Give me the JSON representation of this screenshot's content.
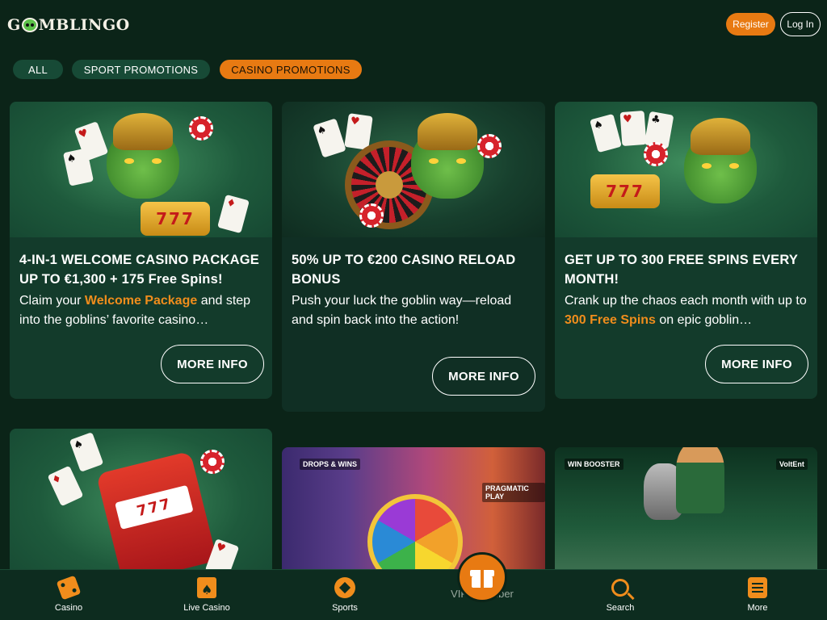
{
  "header": {
    "logo_text": "GOBLINGO",
    "register_label": "Register",
    "login_label": "Log In"
  },
  "tabs": [
    {
      "label": "ALL",
      "active": false
    },
    {
      "label": "SPORT PROMOTIONS",
      "active": false
    },
    {
      "label": "CASINO PROMOTIONS",
      "active": true
    }
  ],
  "promotions": [
    {
      "title": "4-IN-1 WELCOME CASINO PACKAGE UP TO €1,300 + 175 Free Spins!",
      "desc_before": "Claim your ",
      "desc_highlight": "Welcome Package",
      "desc_after": " and step into the goblins’ favorite casino…",
      "button_label": "MORE INFO"
    },
    {
      "title": "50% UP TO €200 CASINO RELOAD BONUS",
      "desc_before": "Push your luck the goblin way—reload and spin back into the action!",
      "desc_highlight": "",
      "desc_after": "",
      "button_label": "MORE INFO"
    },
    {
      "title": "GET UP TO 300 FREE SPINS EVERY MONTH!",
      "desc_before": "Crank up the chaos each month with up to ",
      "desc_highlight": "300 Free Spins",
      "desc_after": " on epic goblin…",
      "button_label": "MORE INFO"
    }
  ],
  "art": {
    "slot_symbols": "777",
    "card_suits": [
      "♥",
      "♠",
      "♦",
      "♣"
    ],
    "provider_tags": [
      "DROPS & WINS",
      "PRAGMATIC PLAY",
      "WIN BOOSTER",
      "VoltEnt"
    ]
  },
  "bottom_nav": [
    {
      "label": "Casino",
      "icon": "dice-icon"
    },
    {
      "label": "Live Casino",
      "icon": "cards-icon"
    },
    {
      "label": "Sports",
      "icon": "football-icon"
    },
    {
      "label": "VIP Chamber",
      "icon": "gift-icon"
    },
    {
      "label": "Search",
      "icon": "search-icon"
    },
    {
      "label": "More",
      "icon": "menu-icon"
    }
  ],
  "colors": {
    "background": "#0b2418",
    "card": "#133b2b",
    "accent": "#e87a12",
    "highlight_text": "#f08d1c",
    "tab_inactive": "#174a36"
  }
}
